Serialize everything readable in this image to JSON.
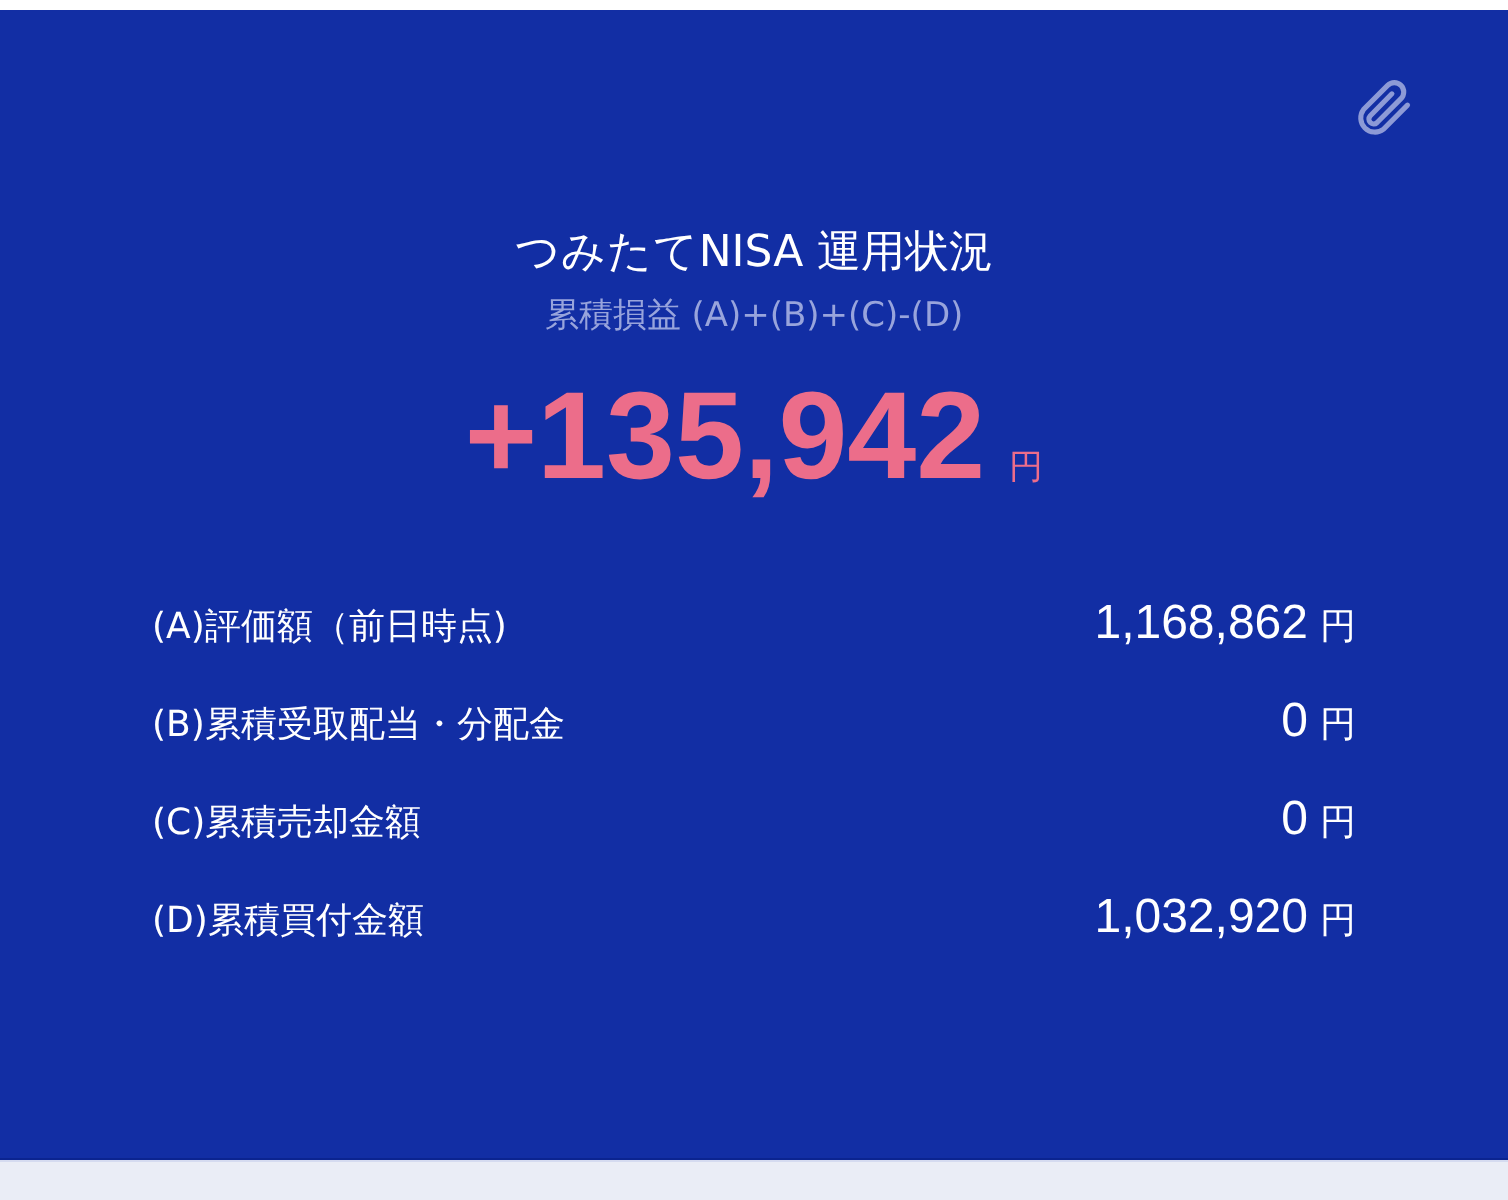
{
  "header": {
    "title": "つみたてNISA 運用状況",
    "subtitle": "累積損益 (A)+(B)+(C)-(D)"
  },
  "total": {
    "amount": "+135,942",
    "unit": "円"
  },
  "rows": [
    {
      "label": "(A)評価額（前日時点)",
      "value": "1,168,862",
      "unit": "円"
    },
    {
      "label": "(B)累積受取配当・分配金",
      "value": "0",
      "unit": "円"
    },
    {
      "label": "(C)累積売却金額",
      "value": "0",
      "unit": "円"
    },
    {
      "label": "(D)累積買付金額",
      "value": "1,032,920",
      "unit": "円"
    }
  ]
}
